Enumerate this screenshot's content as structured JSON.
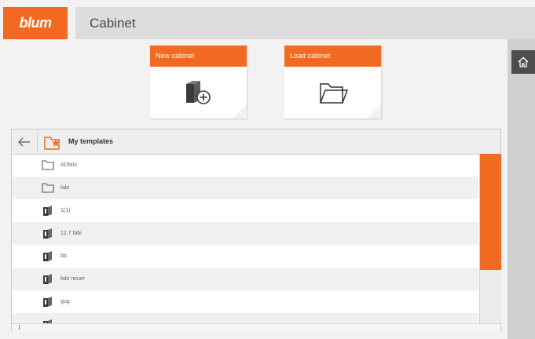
{
  "header": {
    "logo_text": "blum",
    "title": "Cabinet"
  },
  "actions": {
    "new_cabinet_label": "New cabinet",
    "load_cabinet_label": "Load cabinet"
  },
  "templates": {
    "title": "My templates",
    "items": [
      {
        "label": "ADMIs",
        "icon": "folder-icon"
      },
      {
        "label": "fabi",
        "icon": "folder-icon"
      },
      {
        "label": "1(1)",
        "icon": "cabinet-icon"
      },
      {
        "label": "12,7 fabi",
        "icon": "cabinet-icon"
      },
      {
        "label": "bb",
        "icon": "cabinet-icon"
      },
      {
        "label": "fabi neuer",
        "icon": "cabinet-icon"
      },
      {
        "label": "gug",
        "icon": "cabinet-icon"
      },
      {
        "label": "...",
        "icon": "cabinet-icon"
      }
    ]
  },
  "colors": {
    "accent": "#f26a21",
    "dark": "#4d4d4d"
  }
}
